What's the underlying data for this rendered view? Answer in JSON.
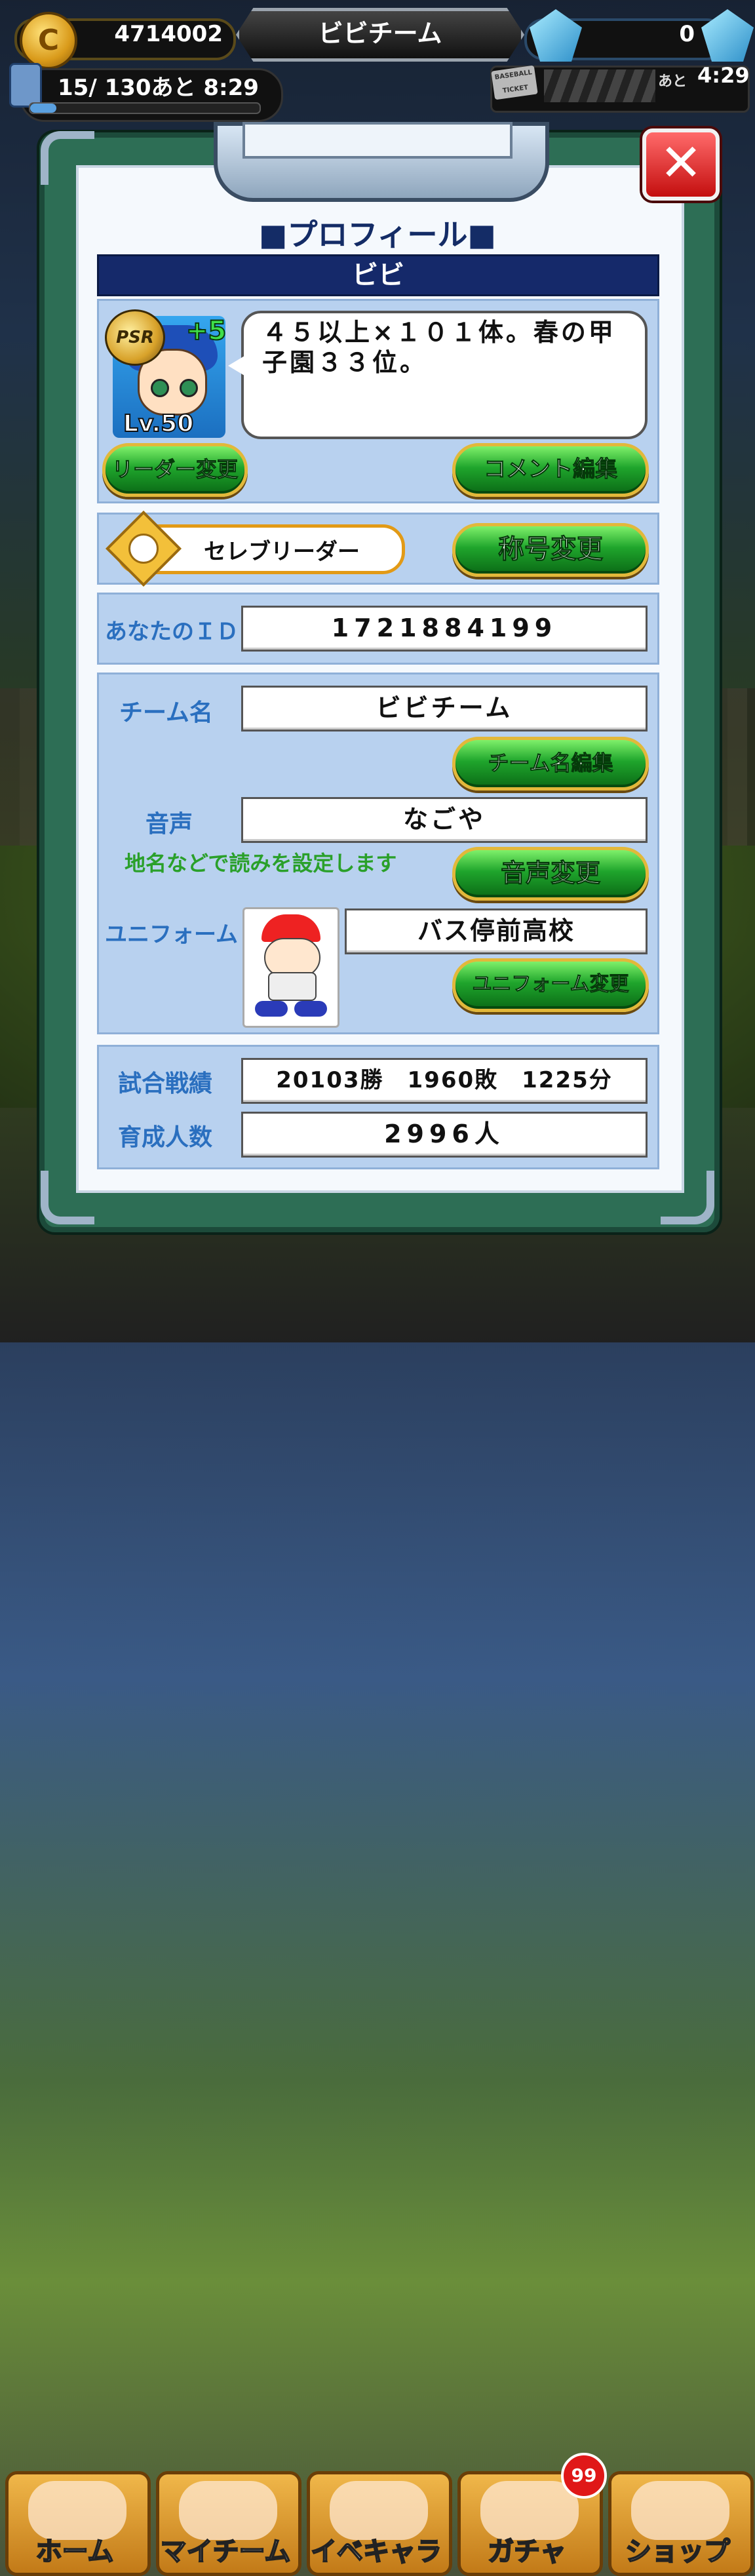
{
  "topbar": {
    "coin_value": "4714002",
    "team_name": "ビビチーム",
    "gem_value": "0",
    "stamina_text": "15/ 130あと  8:29",
    "stamina_fraction": 0.115,
    "ticket_label": "BASEBALL TICKET",
    "ticket_ato": "あと",
    "ticket_time": "4:29"
  },
  "profile": {
    "title": "■プロフィール■",
    "player_name": "ビビ",
    "leader": {
      "rarity": "PSR",
      "plus": "+5",
      "level": "Lv.50"
    },
    "comment": "４５以上×１０１体。春の甲子園３３位。",
    "buttons": {
      "change_leader": "リーダー変更",
      "edit_comment": "コメント編集",
      "change_title": "称号変更",
      "edit_team_name": "チーム名編集",
      "change_voice": "音声変更",
      "change_uniform": "ユニフォーム変更"
    },
    "title_badge": "セレブリーダー",
    "id_label": "あなたのＩＤ",
    "id_value": "1721884199",
    "team_label": "チーム名",
    "team_value": "ビビチーム",
    "voice_label": "音声",
    "voice_value": "なごや",
    "voice_hint": "地名などで読みを設定します",
    "uniform_label": "ユニフォーム",
    "uniform_value": "バス停前高校",
    "record_label": "試合戦績",
    "record_value": "20103勝　1960敗　1225分",
    "trained_label": "育成人数",
    "trained_value": "2996人"
  },
  "nav": {
    "home": "ホーム",
    "my_team": "マイチーム",
    "event_chara": "イベキャラ",
    "gacha": "ガチャ",
    "gacha_badge": "99",
    "shop": "ショップ"
  },
  "colors": {
    "panel_blue": "#b8d1ef",
    "name_bar": "#15296a",
    "button_green": "#1fa52c",
    "label_blue": "#2a6fbf",
    "hint_green": "#2aa02a"
  }
}
